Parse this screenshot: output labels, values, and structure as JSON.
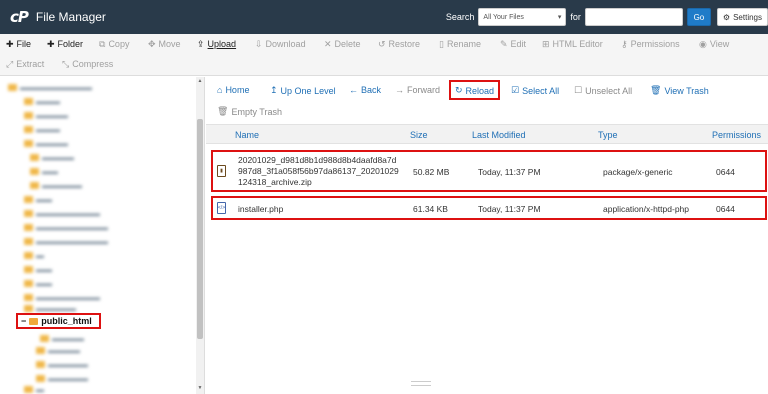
{
  "header": {
    "logo_text": "cP",
    "app_title": "File Manager",
    "search_label": "Search",
    "search_scope": "All Your Files",
    "for_label": "for",
    "search_value": "",
    "go_label": "Go",
    "settings_label": "Settings"
  },
  "toolbar": {
    "row1": [
      {
        "icon": "+",
        "label": "File",
        "active": true
      },
      {
        "icon": "+",
        "label": "Folder",
        "active": true
      },
      {
        "icon": "⧉",
        "label": "Copy",
        "active": false
      },
      {
        "icon": "✥",
        "label": "Move",
        "active": false
      },
      {
        "icon": "⇪",
        "label": "Upload",
        "active": true
      },
      {
        "icon": "⇩",
        "label": "Download",
        "active": false
      },
      {
        "icon": "✕",
        "label": "Delete",
        "active": false
      },
      {
        "icon": "↺",
        "label": "Restore",
        "active": false
      },
      {
        "icon": "▯",
        "label": "Rename",
        "active": false
      },
      {
        "icon": "✎",
        "label": "Edit",
        "active": false
      },
      {
        "icon": "⊞",
        "label": "HTML Editor",
        "active": false
      },
      {
        "icon": "⚷",
        "label": "Permissions",
        "active": false
      },
      {
        "icon": "◉",
        "label": "View",
        "active": false
      }
    ],
    "row2": [
      {
        "icon": "⤢",
        "label": "Extract",
        "active": false
      },
      {
        "icon": "⤡",
        "label": "Compress",
        "active": false
      }
    ]
  },
  "tree": {
    "selected_folder": "public_html",
    "selected_prefix": "−"
  },
  "nav": {
    "home": "Home",
    "up": "Up One Level",
    "back": "Back",
    "forward": "Forward",
    "reload": "Reload",
    "select_all": "Select All",
    "unselect_all": "Unselect All",
    "view_trash": "View Trash",
    "empty_trash": "Empty Trash"
  },
  "table": {
    "columns": {
      "name": "Name",
      "size": "Size",
      "modified": "Last Modified",
      "type": "Type",
      "permissions": "Permissions"
    },
    "rows": [
      {
        "name": "20201029_d981d8b1d988d8b4daafd8a7d987d8_3f1a058f56b97da86137_20201029124318_archive.zip",
        "name_lines": [
          "20201029_d981d8b1d988d8b4daafd8a7d",
          "987d8_3f1a058f56b97da86137_20201029",
          "124318_archive.zip"
        ],
        "size": "50.82 MB",
        "modified": "Today, 11:37 PM",
        "type": "package/x-generic",
        "permissions": "0644",
        "icon": "zip-file-icon"
      },
      {
        "name": "installer.php",
        "size": "61.34 KB",
        "modified": "Today, 11:37 PM",
        "type": "application/x-httpd-php",
        "permissions": "0644",
        "icon": "php-file-icon"
      }
    ]
  },
  "colors": {
    "header_bg": "#293a4a",
    "link_blue": "#1f6fb5",
    "highlight_red": "#dd1111",
    "folder_yellow": "#f0b84a"
  }
}
